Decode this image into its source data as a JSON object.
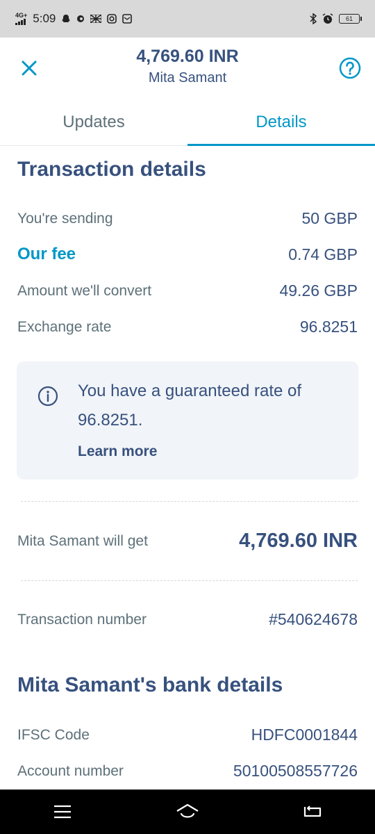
{
  "status_bar": {
    "network": "4G+",
    "time": "5:09",
    "battery": "61"
  },
  "header": {
    "title": "4,769.60 INR",
    "subtitle": "Mita Samant"
  },
  "tabs": [
    {
      "label": "Updates",
      "active": false
    },
    {
      "label": "Details",
      "active": true
    }
  ],
  "transaction": {
    "title": "Transaction details",
    "rows": [
      {
        "label": "You're sending",
        "value": "50 GBP"
      },
      {
        "label": "Our fee",
        "value": "0.74 GBP"
      },
      {
        "label": "Amount we'll convert",
        "value": "49.26 GBP"
      },
      {
        "label": "Exchange rate",
        "value": "96.8251"
      }
    ],
    "info": {
      "text": "You have a guaranteed rate of 96.8251.",
      "link": "Learn more"
    },
    "recipient_gets": {
      "label": "Mita Samant will get",
      "value": "4,769.60 INR"
    },
    "number": {
      "label": "Transaction number",
      "value": "#540624678"
    }
  },
  "bank": {
    "title": "Mita Samant's bank details",
    "rows": [
      {
        "label": "IFSC Code",
        "value": "HDFC0001844"
      },
      {
        "label": "Account number",
        "value": "50100508557726"
      }
    ]
  },
  "colors": {
    "accent": "#0097c7",
    "text_primary": "#37517e",
    "text_secondary": "#5d7079",
    "info_bg": "#f1f4f8"
  }
}
